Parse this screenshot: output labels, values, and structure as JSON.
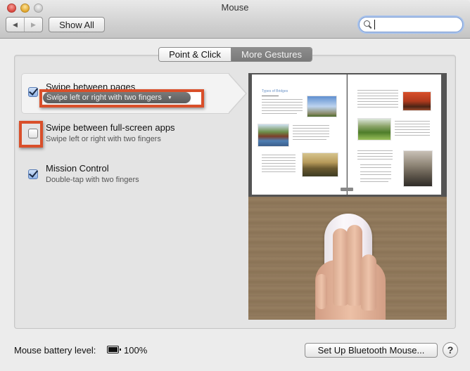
{
  "window": {
    "title": "Mouse",
    "traffic_lights": [
      "close",
      "minimize",
      "zoom"
    ]
  },
  "toolbar": {
    "back_icon": "◀",
    "forward_icon": "▶",
    "show_all_label": "Show All",
    "search": {
      "value": "",
      "placeholder": ""
    }
  },
  "tabs": [
    {
      "label": "Point & Click",
      "selected": false
    },
    {
      "label": "More Gestures",
      "selected": true
    }
  ],
  "gestures": [
    {
      "title": "Swipe between pages",
      "checked": true,
      "popup_value": "Swipe left or right with two fingers",
      "selected": true,
      "highlighted": true
    },
    {
      "title": "Swipe between full-screen apps",
      "subtitle": "Swipe left or right with two fingers",
      "checked": false,
      "highlighted": true
    },
    {
      "title": "Mission Control",
      "subtitle": "Double-tap with two fingers",
      "checked": true
    }
  ],
  "preview": {
    "description": "Video demo: two fingers swiping on Magic Mouse while a book of bridges turns pages",
    "book_title": "Types of Bridges"
  },
  "footer": {
    "battery_label": "Mouse battery level:",
    "battery_percent": "100%",
    "setup_button": "Set Up Bluetooth Mouse...",
    "help_label": "?"
  },
  "colors": {
    "highlight": "#d94f2a",
    "tab_active": "#7f7f7f",
    "checkbox_checked": "#8fb2e6"
  }
}
